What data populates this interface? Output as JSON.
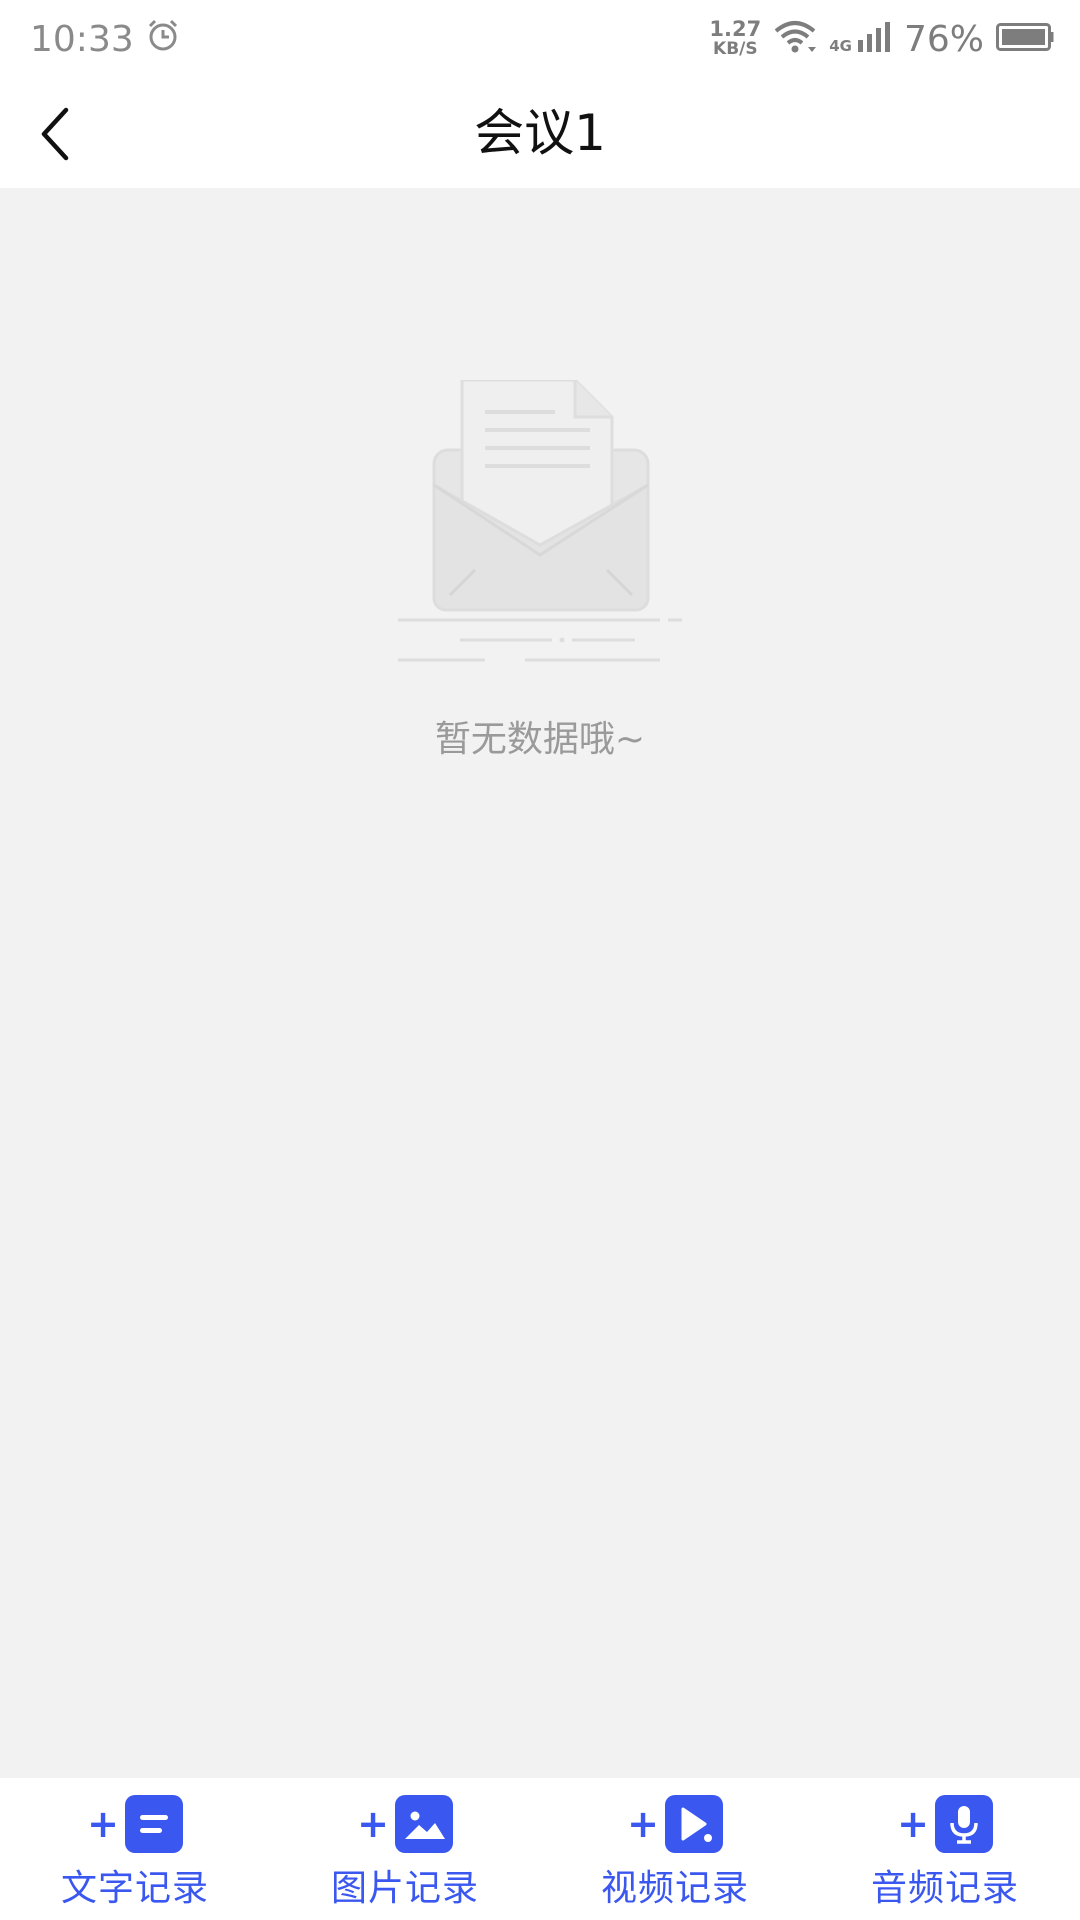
{
  "status_bar": {
    "time": "10:33",
    "alarm_icon": "alarm-clock-icon",
    "net_speed_value": "1.27",
    "net_speed_unit": "KB/S",
    "wifi_icon": "wifi-icon",
    "network_type": "4G",
    "signal_icon": "cell-signal-icon",
    "battery_percent": "76%",
    "battery_icon": "battery-icon"
  },
  "header": {
    "back_icon": "chevron-left-icon",
    "title": "会议1"
  },
  "empty_state": {
    "icon": "empty-envelope-icon",
    "message": "暂无数据哦~"
  },
  "toolbar": {
    "items": [
      {
        "label": "文字记录",
        "icon": "text-record-icon"
      },
      {
        "label": "图片记录",
        "icon": "image-record-icon"
      },
      {
        "label": "视频记录",
        "icon": "video-record-icon"
      },
      {
        "label": "音频记录",
        "icon": "audio-record-icon"
      }
    ]
  },
  "colors": {
    "accent": "#3a57f0",
    "page_background": "#f2f2f2",
    "bar_background": "#ffffff",
    "muted_text": "#9a9a9a"
  }
}
